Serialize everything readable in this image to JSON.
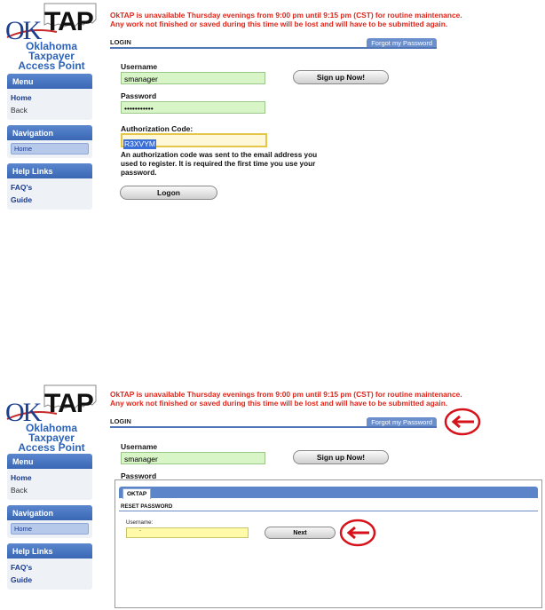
{
  "notice": {
    "line1": "OkTAP is unavailable Thursday evenings from 9:00 pm until 9:15 pm (CST) for routine maintenance.",
    "line2": "Any work not finished or saved during this time will be lost and will have to be submitted again."
  },
  "logo": {
    "ok": "OK",
    "tap": "TAP",
    "line1": "Oklahoma Taxpayer",
    "line2": "Access Point"
  },
  "nav": {
    "menu_title": "Menu",
    "menu_items": [
      "Home",
      "Back"
    ],
    "navigation_title": "Navigation",
    "navigation_selected": "Home",
    "help_title": "Help Links",
    "help_items": [
      "FAQ's",
      "Guide"
    ]
  },
  "login": {
    "section_label": "LOGIN",
    "forgot_tab": "Forgot my Password",
    "username_label": "Username",
    "username_value": "smanager",
    "password_label": "Password",
    "password_value": "•••••••••••",
    "signup_button": "Sign up Now!",
    "auth_label": "Authorization Code:",
    "auth_value": "R3XVYM",
    "auth_help": "An authorization code was sent to the email address you used to register. It is required the first time you use your password.",
    "logon_button": "Logon"
  },
  "reset": {
    "tab": "OKTAP",
    "heading": "RESET PASSWORD",
    "username_label": "Username:",
    "username_value": ".",
    "next_button": "Next"
  },
  "colors": {
    "notice": "#e0261b",
    "nav_header": "#3a67b4",
    "field_green": "#d8f5c8",
    "highlight_red": "#d6121a"
  }
}
